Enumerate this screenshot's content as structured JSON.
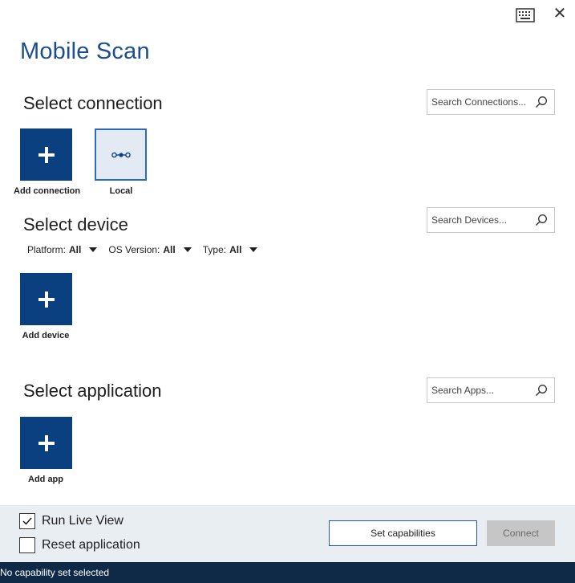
{
  "app": {
    "title": "Mobile Scan"
  },
  "window": {
    "keyboard_icon": "keyboard-icon",
    "close_icon": "close-icon",
    "close_glyph": "✕"
  },
  "connections": {
    "title": "Select connection",
    "search_placeholder": "Search Connections...",
    "tiles": [
      {
        "label": "Add connection",
        "icon": "plus-icon"
      },
      {
        "label": "Local",
        "icon": "connection-dots-icon"
      }
    ]
  },
  "devices": {
    "title": "Select device",
    "search_placeholder": "Search Devices...",
    "filters": [
      {
        "label": "Platform:",
        "value": "All"
      },
      {
        "label": "OS Version:",
        "value": "All"
      },
      {
        "label": "Type:",
        "value": "All"
      }
    ],
    "tiles": [
      {
        "label": "Add device",
        "icon": "plus-icon"
      }
    ]
  },
  "applications": {
    "title": "Select application",
    "search_placeholder": "Search Apps...",
    "tiles": [
      {
        "label": "Add app",
        "icon": "plus-icon"
      }
    ]
  },
  "options": {
    "run_live_view": {
      "label": "Run Live View",
      "checked": true
    },
    "reset_application": {
      "label": "Reset application",
      "checked": false
    }
  },
  "buttons": {
    "set_capabilities": "Set capabilities",
    "connect": "Connect"
  },
  "status": {
    "text": "No capability set selected"
  },
  "colors": {
    "accent": "#0a3f80",
    "title": "#1b4f8f",
    "status_bar": "#0e2a47",
    "panel": "#e9eef3"
  }
}
